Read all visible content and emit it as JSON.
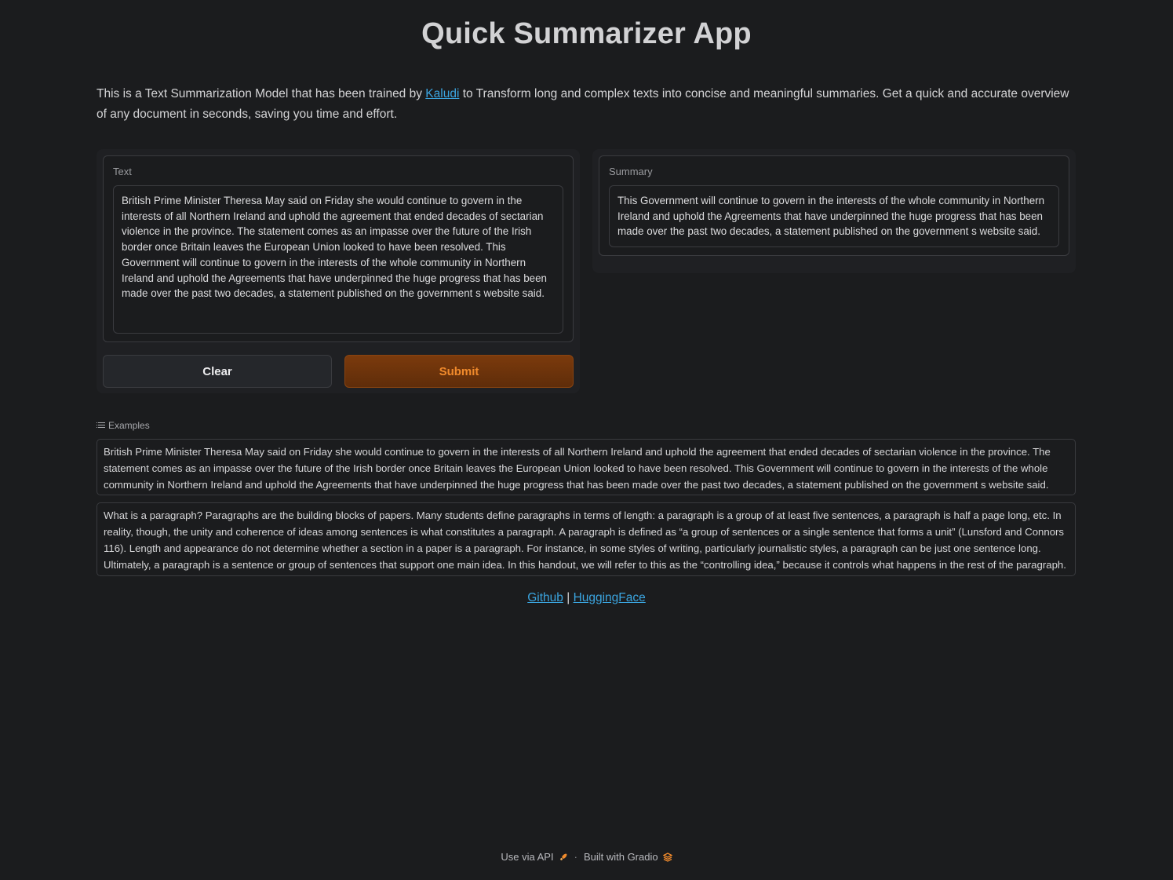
{
  "header": {
    "title": "Quick Summarizer App"
  },
  "description": {
    "before_link": "This is a Text Summarization Model that has been trained by ",
    "link_text": "Kaludi",
    "after_link": " to Transform long and complex texts into concise and meaningful summaries. Get a quick and accurate overview of any document in seconds, saving you time and effort."
  },
  "input": {
    "label": "Text",
    "value": "British Prime Minister Theresa May said on Friday she would continue to govern in the interests of all Northern Ireland and uphold the agreement that ended decades of sectarian violence in the province. The statement comes as an impasse over the future of the Irish border once Britain leaves the European Union looked to have been resolved. This Government will continue to govern in the interests of the whole community in Northern Ireland and uphold the Agreements that have underpinned the huge progress that has been made over the past two decades, a statement published on the government s website said."
  },
  "output": {
    "label": "Summary",
    "value": "This Government will continue to govern in the interests of the whole community in Northern Ireland and uphold the Agreements that have underpinned the huge progress that has been made over the past two decades, a statement published on the government s website said."
  },
  "buttons": {
    "clear_label": "Clear",
    "submit_label": "Submit",
    "submit_color": "#f08a2c"
  },
  "examples": {
    "header": "Examples",
    "icon": "list-icon",
    "items": [
      "British Prime Minister Theresa May said on Friday she would continue to govern in the interests of all Northern Ireland and uphold the agreement that ended decades of sectarian violence in the province. The statement comes as an impasse over the future of the Irish border once Britain leaves the European Union looked to have been resolved. This Government will continue to govern in the interests of the whole community in Northern Ireland and uphold the Agreements that have underpinned the huge progress that has been made over the past two decades, a statement published on the government s website said.",
      "What is a paragraph? Paragraphs are the building blocks of papers. Many students define paragraphs in terms of length: a paragraph is a group of at least five sentences, a paragraph is half a page long, etc. In reality, though, the unity and coherence of ideas among sentences is what constitutes a paragraph. A paragraph is defined as “a group of sentences or a single sentence that forms a unit” (Lunsford and Connors 116). Length and appearance do not determine whether a section in a paper is a paragraph. For instance, in some styles of writing, particularly journalistic styles, a paragraph can be just one sentence long. Ultimately, a paragraph is a sentence or group of sentences that support one main idea. In this handout, we will refer to this as the “controlling idea,” because it controls what happens in the rest of the paragraph."
    ]
  },
  "links": {
    "github": "Github",
    "separator": "|",
    "huggingface": "HuggingFace"
  },
  "footer": {
    "api_label": "Use via API",
    "separator": "·",
    "built_with": "Built with Gradio",
    "api_icon": "rocket-icon",
    "gradio_icon": "gradio-logo-icon"
  }
}
